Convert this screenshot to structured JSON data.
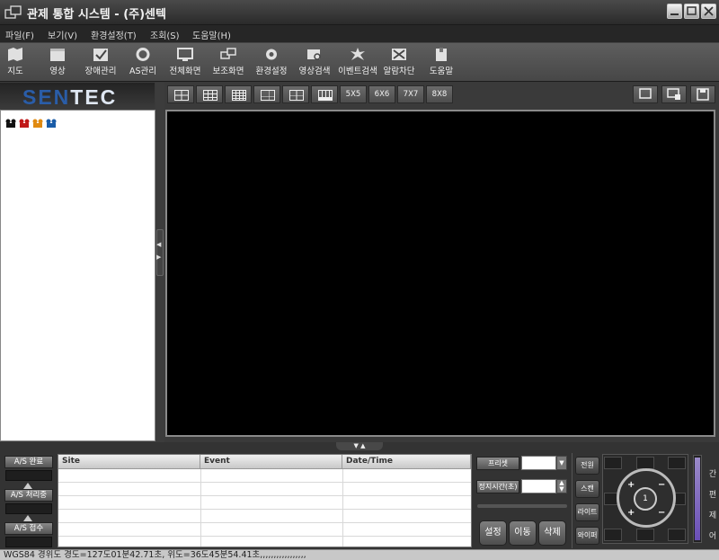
{
  "window": {
    "title": "관제 통합 시스템 - (주)센텍"
  },
  "menu": [
    "파일(F)",
    "보기(V)",
    "환경설정(T)",
    "조회(S)",
    "도움말(H)"
  ],
  "toolbar": [
    "지도",
    "영상",
    "장애관리",
    "AS관리",
    "전체화면",
    "보조화면",
    "환경설정",
    "영상검색",
    "이벤트검색",
    "알람차단",
    "도움말"
  ],
  "logo": {
    "part1": "SEN",
    "part2": "TEC"
  },
  "layout_buttons": [
    "5X5",
    "6X6",
    "7X7",
    "8X8"
  ],
  "as_panel": {
    "done": "A/S 완료",
    "processing": "A/S 처리중",
    "received": "A/S 접수"
  },
  "event_table": {
    "columns": [
      "Site",
      "Event",
      "Date/Time"
    ],
    "rows": []
  },
  "preset": {
    "preset_label": "프리셋",
    "dwell_label": "정지시간(초)",
    "set_btn": "설정",
    "move_btn": "이동",
    "delete_btn": "삭제"
  },
  "ptz": {
    "side": [
      "전원",
      "스캔",
      "라이트",
      "와이퍼"
    ],
    "center": "1",
    "vertical": [
      "간",
      "편",
      "제",
      "어"
    ]
  },
  "status": "WGS84 경위도 경도=127도01분42.71초, 위도=36도45분54.41초,,,,,,,,,,,,,,,,,",
  "colors": {
    "accent": "#2a5da8",
    "video_bg": "#000000",
    "slider": "#6a4fb8"
  }
}
